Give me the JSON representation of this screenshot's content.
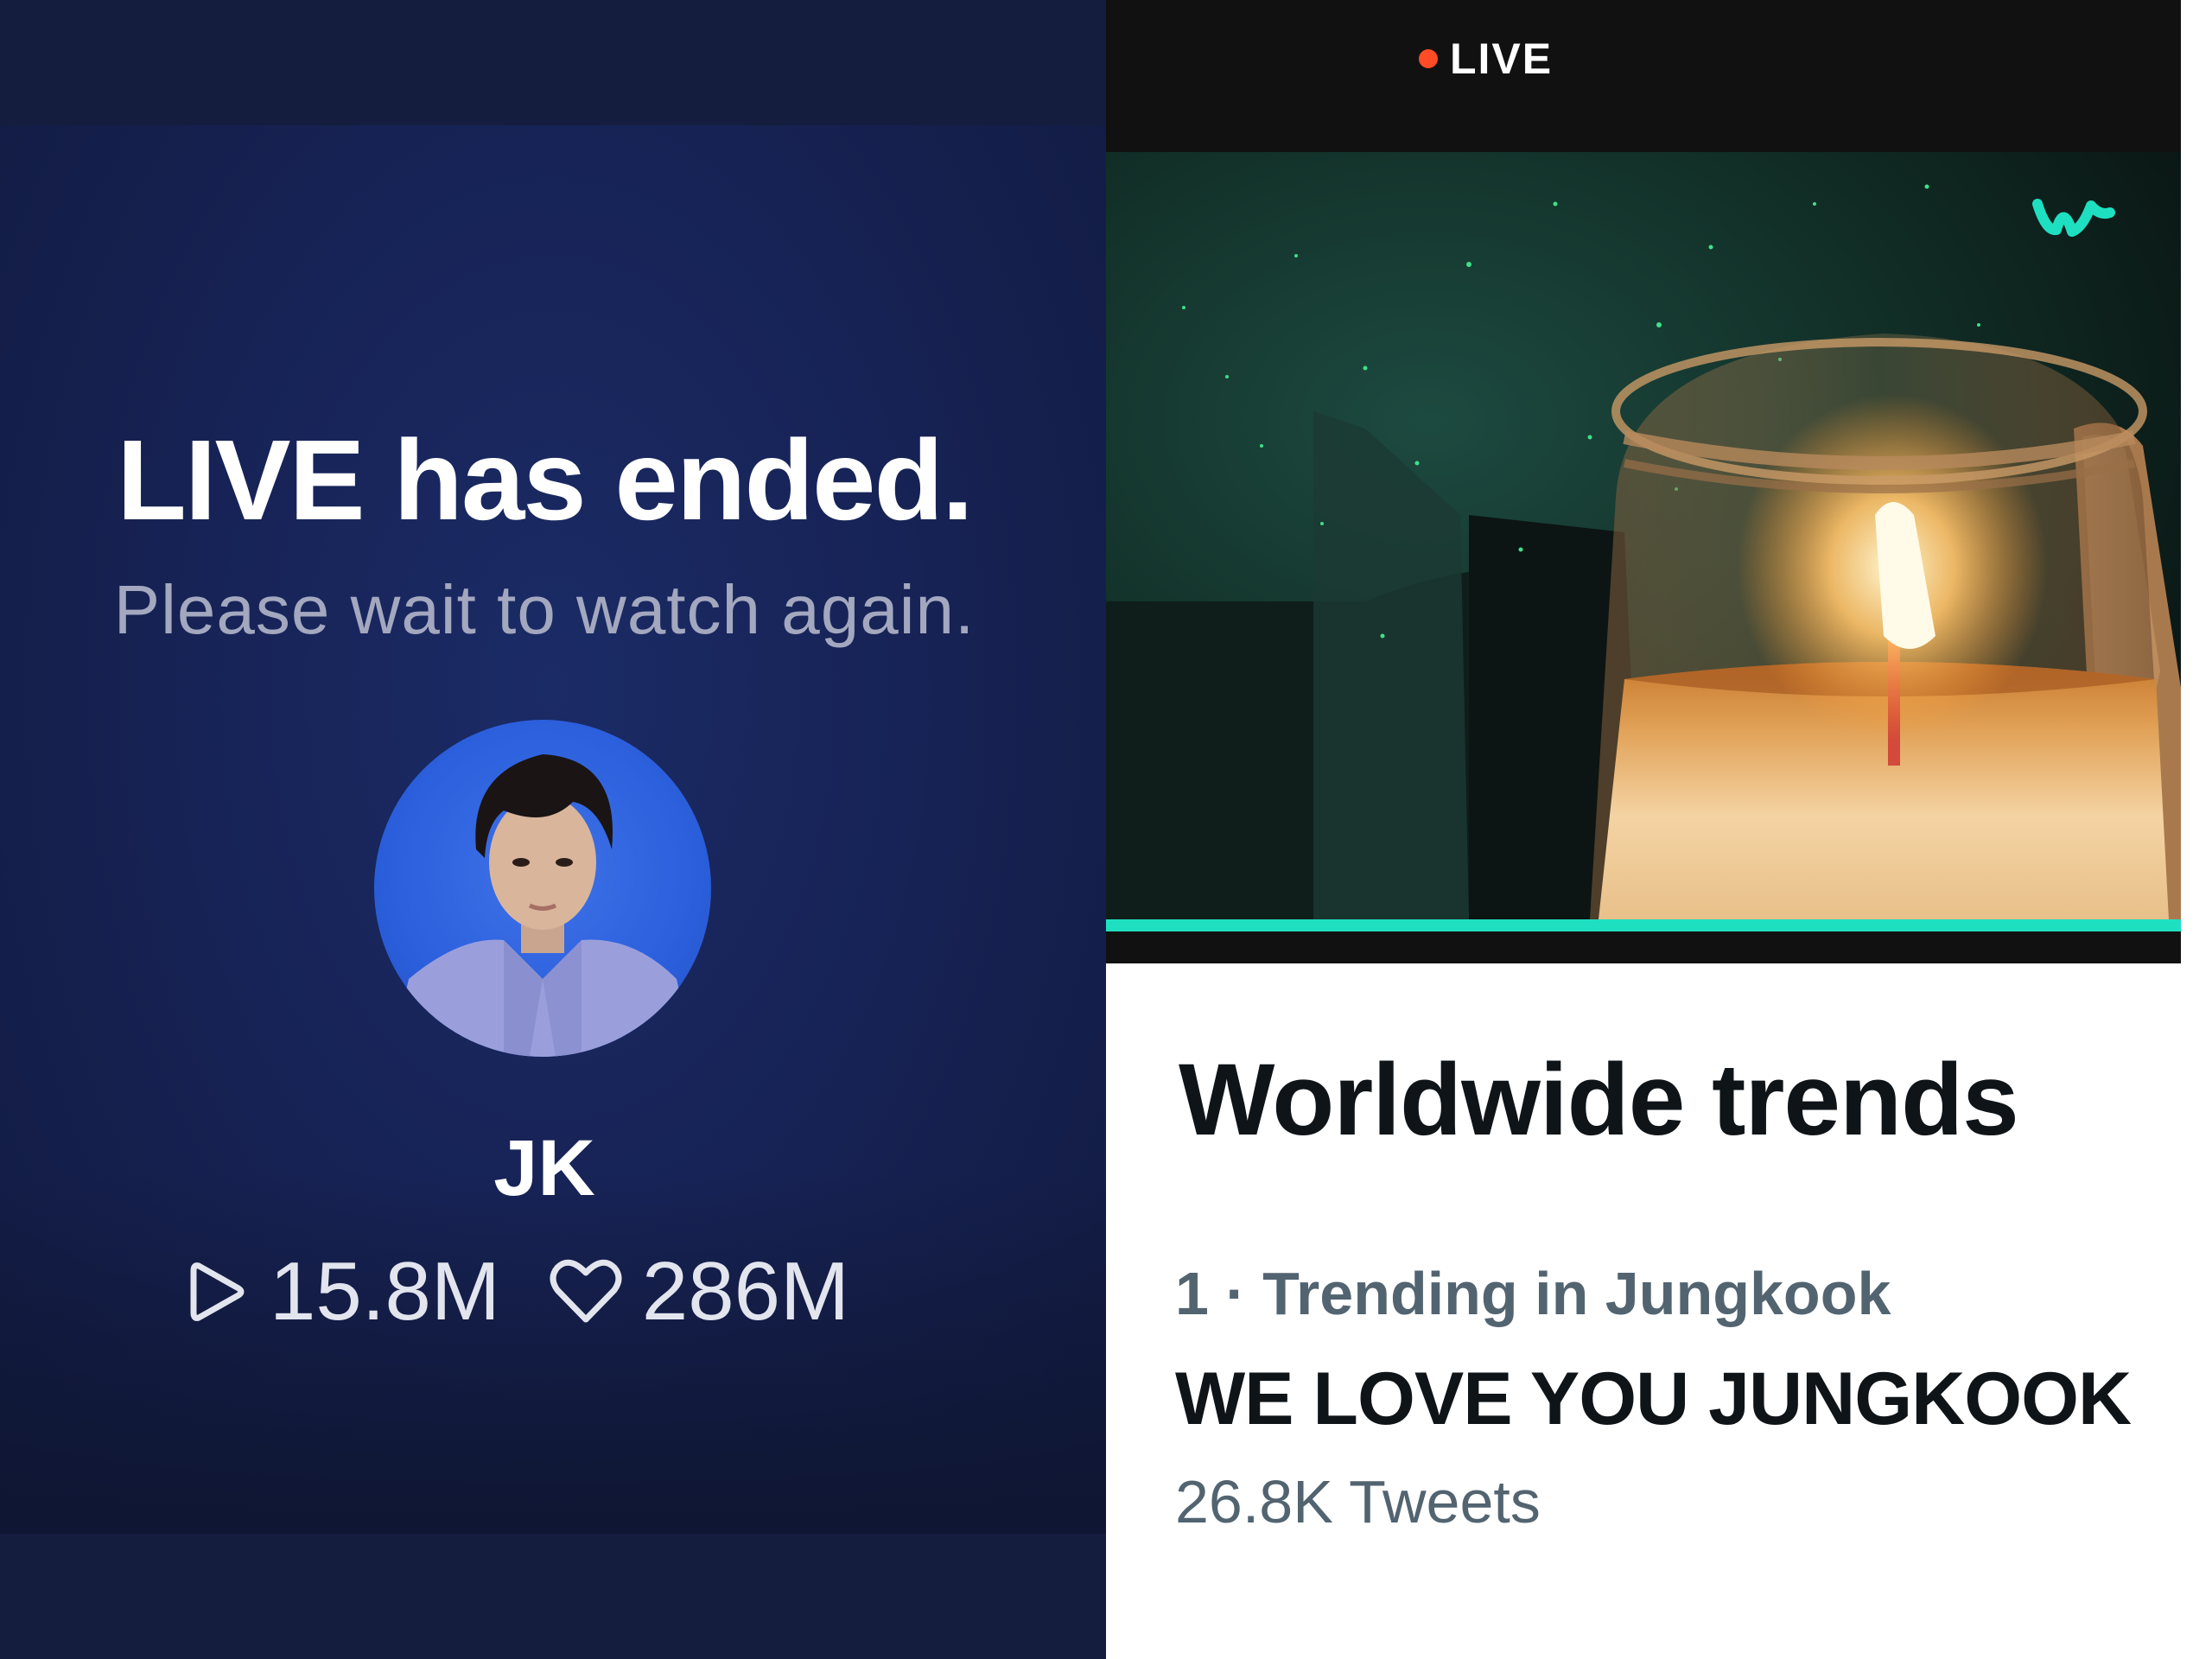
{
  "left_panel": {
    "title": "LIVE has ended.",
    "subtitle": "Please wait to watch again.",
    "user_name": "JK",
    "stats": {
      "plays": "15.8M",
      "likes": "286M"
    }
  },
  "right_panel": {
    "player": {
      "live_label": "LIVE",
      "logo_icon": "weverse-logo-icon",
      "accent_color": "#1ee0c1"
    },
    "trends": {
      "title": "Worldwide trends",
      "meta": "1 · Trending in Jungkook",
      "name": "WE LOVE YOU JUNGKOOK",
      "count": "26.8K Tweets"
    }
  }
}
